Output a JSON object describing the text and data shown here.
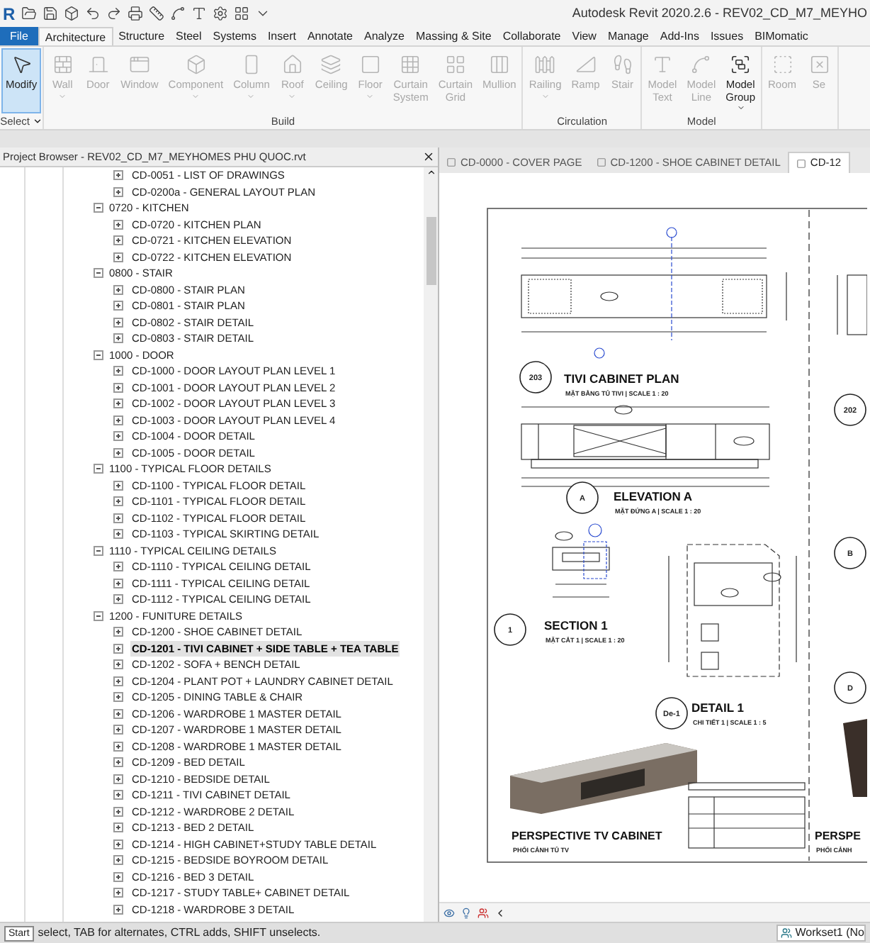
{
  "app": {
    "logo": "R"
  },
  "window": {
    "title": "Autodesk Revit 2020.2.6 - REV02_CD_M7_MEYHO"
  },
  "ribbon": {
    "tabs": [
      {
        "label": "File",
        "kind": "file",
        "selected": false
      },
      {
        "label": "Architecture",
        "kind": "tab",
        "selected": true
      },
      {
        "label": "Structure",
        "kind": "tab",
        "selected": false
      },
      {
        "label": "Steel",
        "kind": "tab",
        "selected": false
      },
      {
        "label": "Systems",
        "kind": "tab",
        "selected": false
      },
      {
        "label": "Insert",
        "kind": "tab",
        "selected": false
      },
      {
        "label": "Annotate",
        "kind": "tab",
        "selected": false
      },
      {
        "label": "Analyze",
        "kind": "tab",
        "selected": false
      },
      {
        "label": "Massing & Site",
        "kind": "tab",
        "selected": false
      },
      {
        "label": "Collaborate",
        "kind": "tab",
        "selected": false
      },
      {
        "label": "View",
        "kind": "tab",
        "selected": false
      },
      {
        "label": "Manage",
        "kind": "tab",
        "selected": false
      },
      {
        "label": "Add-Ins",
        "kind": "tab",
        "selected": false
      },
      {
        "label": "Issues",
        "kind": "tab",
        "selected": false
      },
      {
        "label": "BIMomatic",
        "kind": "tab",
        "selected": false
      }
    ],
    "panels": [
      {
        "title": "Select",
        "has_menu": true,
        "buttons": [
          {
            "label": "Modify",
            "selected": true,
            "disabled": false,
            "has_menu": false
          }
        ]
      },
      {
        "title": "Build",
        "has_menu": false,
        "buttons": [
          {
            "label": "Wall",
            "selected": false,
            "disabled": true,
            "has_menu": true
          },
          {
            "label": "Door",
            "selected": false,
            "disabled": true,
            "has_menu": false
          },
          {
            "label": "Window",
            "selected": false,
            "disabled": true,
            "has_menu": false
          },
          {
            "label": "Component",
            "selected": false,
            "disabled": true,
            "has_menu": true
          },
          {
            "label": "Column",
            "selected": false,
            "disabled": true,
            "has_menu": true
          },
          {
            "label": "Roof",
            "selected": false,
            "disabled": true,
            "has_menu": true
          },
          {
            "label": "Ceiling",
            "selected": false,
            "disabled": true,
            "has_menu": false
          },
          {
            "label": "Floor",
            "selected": false,
            "disabled": true,
            "has_menu": true
          },
          {
            "label": "Curtain System",
            "selected": false,
            "disabled": true,
            "has_menu": false
          },
          {
            "label": "Curtain Grid",
            "selected": false,
            "disabled": true,
            "has_menu": false
          },
          {
            "label": "Mullion",
            "selected": false,
            "disabled": true,
            "has_menu": false
          }
        ]
      },
      {
        "title": "Circulation",
        "has_menu": false,
        "buttons": [
          {
            "label": "Railing",
            "selected": false,
            "disabled": true,
            "has_menu": true
          },
          {
            "label": "Ramp",
            "selected": false,
            "disabled": true,
            "has_menu": false
          },
          {
            "label": "Stair",
            "selected": false,
            "disabled": true,
            "has_menu": false
          }
        ]
      },
      {
        "title": "Model",
        "has_menu": false,
        "buttons": [
          {
            "label": "Model Text",
            "selected": false,
            "disabled": true,
            "has_menu": false
          },
          {
            "label": "Model Line",
            "selected": false,
            "disabled": true,
            "has_menu": false
          },
          {
            "label": "Model Group",
            "selected": false,
            "disabled": false,
            "has_menu": true
          }
        ]
      },
      {
        "buttons": [
          {
            "label": "Room",
            "selected": false,
            "disabled": true,
            "has_menu": false
          },
          {
            "label": "Se",
            "selected": false,
            "disabled": true,
            "has_menu": false
          }
        ]
      }
    ]
  },
  "project_browser": {
    "title": "Project Browser - REV02_CD_M7_MEYHOMES PHU QUOC.rvt",
    "tree": [
      {
        "children": [
          {
            "label": "CD-0051 - LIST OF DRAWINGS",
            "selected": false
          },
          {
            "label": "CD-0200a - GENERAL LAYOUT PLAN",
            "selected": false
          }
        ]
      },
      {
        "label": "0720 - KITCHEN",
        "expanded": true,
        "children": [
          {
            "label": "CD-0720 - KITCHEN PLAN",
            "selected": false
          },
          {
            "label": "CD-0721 - KITCHEN ELEVATION",
            "selected": false
          },
          {
            "label": "CD-0722 - KITCHEN ELEVATION",
            "selected": false
          }
        ]
      },
      {
        "label": "0800 - STAIR",
        "expanded": true,
        "children": [
          {
            "label": "CD-0800 - STAIR PLAN",
            "selected": false
          },
          {
            "label": "CD-0801 - STAIR PLAN",
            "selected": false
          },
          {
            "label": "CD-0802 - STAIR DETAIL",
            "selected": false
          },
          {
            "label": "CD-0803 - STAIR DETAIL",
            "selected": false
          }
        ]
      },
      {
        "label": "1000 - DOOR",
        "expanded": true,
        "children": [
          {
            "label": "CD-1000 - DOOR LAYOUT PLAN LEVEL 1",
            "selected": false
          },
          {
            "label": "CD-1001 - DOOR LAYOUT PLAN LEVEL 2",
            "selected": false
          },
          {
            "label": "CD-1002 - DOOR LAYOUT PLAN LEVEL 3",
            "selected": false
          },
          {
            "label": "CD-1003 - DOOR LAYOUT PLAN LEVEL 4",
            "selected": false
          },
          {
            "label": "CD-1004 - DOOR DETAIL",
            "selected": false
          },
          {
            "label": "CD-1005 - DOOR DETAIL",
            "selected": false
          }
        ]
      },
      {
        "label": "1100 - TYPICAL FLOOR DETAILS",
        "expanded": true,
        "children": [
          {
            "label": "CD-1100 - TYPICAL FLOOR DETAIL",
            "selected": false
          },
          {
            "label": "CD-1101 - TYPICAL FLOOR DETAIL",
            "selected": false
          },
          {
            "label": "CD-1102 - TYPICAL FLOOR DETAIL",
            "selected": false
          },
          {
            "label": "CD-1103 - TYPICAL SKIRTING DETAIL",
            "selected": false
          }
        ]
      },
      {
        "label": "1110 - TYPICAL CEILING DETAILS",
        "expanded": true,
        "children": [
          {
            "label": "CD-1110 - TYPICAL CEILING DETAIL",
            "selected": false
          },
          {
            "label": "CD-1111 - TYPICAL CEILING DETAIL",
            "selected": false
          },
          {
            "label": "CD-1112 - TYPICAL CEILING DETAIL",
            "selected": false
          }
        ]
      },
      {
        "label": "1200 - FUNITURE DETAILS",
        "expanded": true,
        "children": [
          {
            "label": "CD-1200 - SHOE CABINET DETAIL",
            "selected": false
          },
          {
            "label": "CD-1201 - TIVI CABINET + SIDE TABLE + TEA TABLE",
            "selected": true
          },
          {
            "label": "CD-1202 - SOFA + BENCH DETAIL",
            "selected": false
          },
          {
            "label": "CD-1204 - PLANT POT + LAUNDRY CABINET DETAIL",
            "selected": false
          },
          {
            "label": "CD-1205 - DINING TABLE & CHAIR",
            "selected": false
          },
          {
            "label": "CD-1206 - WARDROBE 1 MASTER DETAIL",
            "selected": false
          },
          {
            "label": "CD-1207 - WARDROBE 1 MASTER DETAIL",
            "selected": false
          },
          {
            "label": "CD-1208 - WARDROBE 1 MASTER DETAIL",
            "selected": false
          },
          {
            "label": "CD-1209 - BED DETAIL",
            "selected": false
          },
          {
            "label": "CD-1210 - BEDSIDE DETAIL",
            "selected": false
          },
          {
            "label": "CD-1211 - TIVI CABINET DETAIL",
            "selected": false
          },
          {
            "label": "CD-1212 - WARDROBE 2  DETAIL",
            "selected": false
          },
          {
            "label": "CD-1213 - BED 2 DETAIL",
            "selected": false
          },
          {
            "label": "CD-1214 - HIGH CABINET+STUDY TABLE DETAIL",
            "selected": false
          },
          {
            "label": "CD-1215 - BEDSIDE BOYROOM DETAIL",
            "selected": false
          },
          {
            "label": "CD-1216 - BED 3 DETAIL",
            "selected": false
          },
          {
            "label": "CD-1217 - STUDY TABLE+ CABINET DETAIL",
            "selected": false
          },
          {
            "label": "CD-1218 - WARDROBE 3  DETAIL",
            "selected": false
          }
        ]
      }
    ]
  },
  "view_tabs": [
    {
      "label": "CD-0000 - COVER PAGE",
      "selected": false
    },
    {
      "label": "CD-1200 - SHOE CABINET DETAIL",
      "selected": false
    },
    {
      "label": "CD-12",
      "selected": true
    }
  ],
  "sheet": {
    "views": [
      {
        "kind": "plan",
        "marker": "203",
        "title": "TIVI CABINET PLAN",
        "subtitle": "MẶT BẰNG TỦ TIVI | SCALE  1 : 20"
      },
      {
        "kind": "elevation",
        "marker": "A",
        "title": "ELEVATION A",
        "subtitle": "MẶT ĐỨNG A | SCALE  1 : 20"
      },
      {
        "kind": "section",
        "marker": "1",
        "title": "SECTION 1",
        "subtitle": "MẶT CẮT 1 | SCALE  1 : 20"
      },
      {
        "kind": "detail",
        "marker": "De-1",
        "title": "DETAIL 1",
        "subtitle": "CHI TIẾT 1 | SCALE  1 : 5"
      },
      {
        "kind": "perspective",
        "title": "PERSPECTIVE TV CABINET",
        "subtitle": "PHỐI CẢNH TỦ TV"
      }
    ],
    "right_column": {
      "markers": [
        "202",
        "B",
        "D"
      ],
      "title": "PERSPE",
      "subtitle": "PHỐI CẢNH"
    }
  },
  "status_bar": {
    "badge": "Start",
    "hint": "select, TAB for alternates, CTRL adds, SHIFT unselects.",
    "workset": "Workset1 (No"
  }
}
